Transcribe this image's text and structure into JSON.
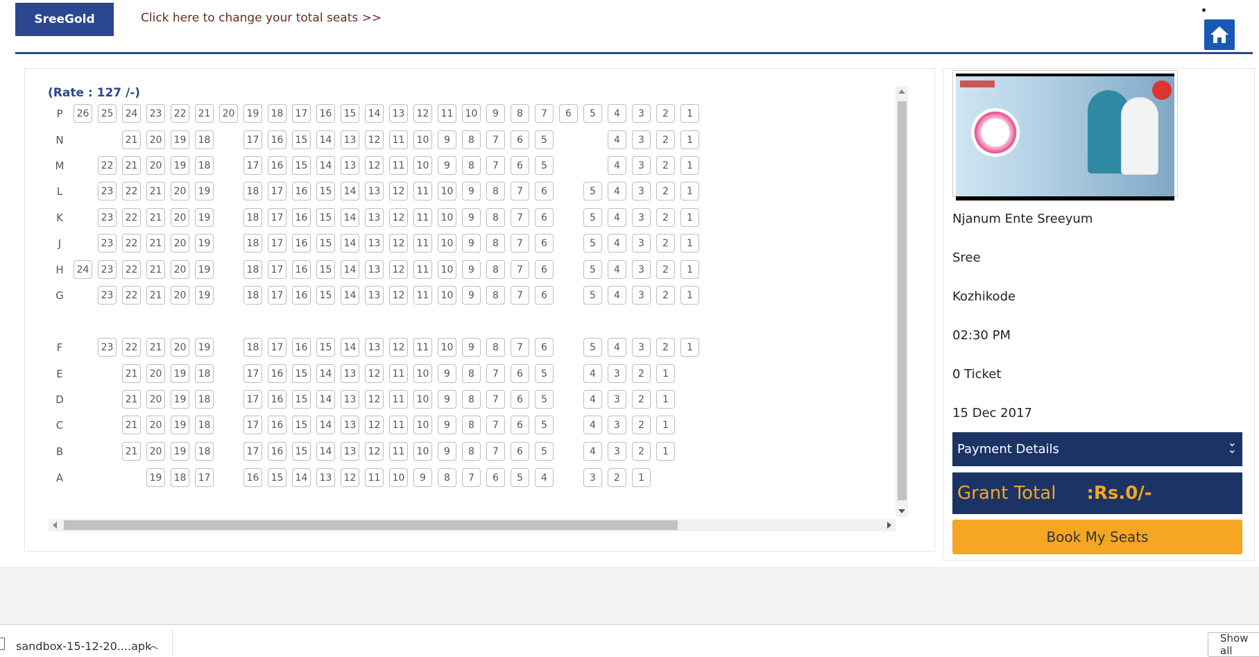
{
  "header": {
    "theatre_button": "SreeGold",
    "change_seats_link": "Click here to change your total seats >>"
  },
  "seat_layout": {
    "rate": "(Rate : 127 /-)",
    "rows": [
      {
        "label": "P",
        "seats": [
          26,
          25,
          24,
          23,
          22,
          21,
          20,
          19,
          18,
          17,
          16,
          15,
          14,
          13,
          12,
          11,
          10,
          9,
          8,
          7,
          6,
          5,
          4,
          3,
          2,
          1
        ]
      },
      {
        "label": "N",
        "seats": [
          21,
          20,
          19,
          18,
          17,
          16,
          15,
          14,
          13,
          12,
          11,
          10,
          9,
          8,
          7,
          6,
          5,
          4,
          3,
          2,
          1
        ]
      },
      {
        "label": "M",
        "seats": [
          22,
          21,
          20,
          19,
          18,
          17,
          16,
          15,
          14,
          13,
          12,
          11,
          10,
          9,
          8,
          7,
          6,
          5,
          4,
          3,
          2,
          1
        ]
      },
      {
        "label": "L",
        "seats": [
          23,
          22,
          21,
          20,
          19,
          18,
          17,
          16,
          15,
          14,
          13,
          12,
          11,
          10,
          9,
          8,
          7,
          6,
          5,
          4,
          3,
          2,
          1
        ]
      },
      {
        "label": "K",
        "seats": [
          23,
          22,
          21,
          20,
          19,
          18,
          17,
          16,
          15,
          14,
          13,
          12,
          11,
          10,
          9,
          8,
          7,
          6,
          5,
          4,
          3,
          2,
          1
        ]
      },
      {
        "label": "J",
        "seats": [
          23,
          22,
          21,
          20,
          19,
          18,
          17,
          16,
          15,
          14,
          13,
          12,
          11,
          10,
          9,
          8,
          7,
          6,
          5,
          4,
          3,
          2,
          1
        ]
      },
      {
        "label": "H",
        "seats": [
          24,
          23,
          22,
          21,
          20,
          19,
          18,
          17,
          16,
          15,
          14,
          13,
          12,
          11,
          10,
          9,
          8,
          7,
          6,
          5,
          4,
          3,
          2,
          1
        ]
      },
      {
        "label": "G",
        "seats": [
          23,
          22,
          21,
          20,
          19,
          18,
          17,
          16,
          15,
          14,
          13,
          12,
          11,
          10,
          9,
          8,
          7,
          6,
          5,
          4,
          3,
          2,
          1
        ]
      },
      {
        "label": "F",
        "seats": [
          23,
          22,
          21,
          20,
          19,
          18,
          17,
          16,
          15,
          14,
          13,
          12,
          11,
          10,
          9,
          8,
          7,
          6,
          5,
          4,
          3,
          2,
          1
        ]
      },
      {
        "label": "E",
        "seats": [
          21,
          20,
          19,
          18,
          17,
          16,
          15,
          14,
          13,
          12,
          11,
          10,
          9,
          8,
          7,
          6,
          5,
          4,
          3,
          2,
          1
        ]
      },
      {
        "label": "D",
        "seats": [
          21,
          20,
          19,
          18,
          17,
          16,
          15,
          14,
          13,
          12,
          11,
          10,
          9,
          8,
          7,
          6,
          5,
          4,
          3,
          2,
          1
        ]
      },
      {
        "label": "C",
        "seats": [
          21,
          20,
          19,
          18,
          17,
          16,
          15,
          14,
          13,
          12,
          11,
          10,
          9,
          8,
          7,
          6,
          5,
          4,
          3,
          2,
          1
        ]
      },
      {
        "label": "B",
        "seats": [
          21,
          20,
          19,
          18,
          17,
          16,
          15,
          14,
          13,
          12,
          11,
          10,
          9,
          8,
          7,
          6,
          5,
          4,
          3,
          2,
          1
        ]
      },
      {
        "label": "A",
        "seats": [
          19,
          18,
          17,
          16,
          15,
          14,
          13,
          12,
          11,
          10,
          9,
          8,
          7,
          6,
          5,
          4,
          3,
          2,
          1
        ]
      }
    ]
  },
  "booking": {
    "movie": "Njanum Ente Sreeyum",
    "theatre": "Sree",
    "city": "Kozhikode",
    "time": "02:30 PM",
    "tickets": "0 Ticket",
    "date": "15 Dec 2017",
    "payment_details": "Payment Details",
    "grant_total_label": "Grant Total",
    "grant_total_value": ":Rs.0/-",
    "book_button": "Book My Seats"
  },
  "downloads": {
    "file_name": "sandbox-15-12-20....apk",
    "show_all": "Show all"
  },
  "colors": {
    "brand_blue": "#2b4790",
    "panel_navy": "#1c3365",
    "accent_orange": "#f5a623",
    "home_blue": "#1a58b5"
  }
}
